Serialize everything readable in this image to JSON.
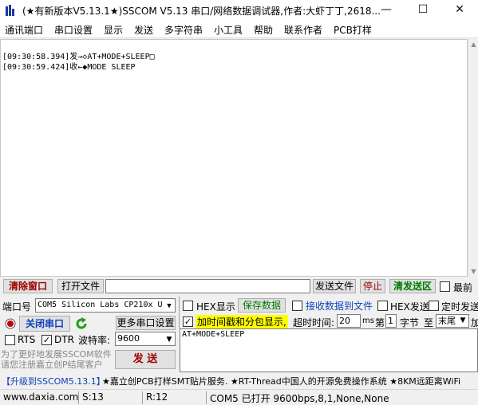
{
  "window": {
    "title": "(★有新版本V5.13.1★)SSCOM V5.13 串口/网络数据调试器,作者:大虾丁丁,2618...",
    "min_glyph": "—",
    "max_glyph": "☐",
    "close_glyph": "✕"
  },
  "menu": [
    "通讯端口",
    "串口设置",
    "显示",
    "发送",
    "多字符串",
    "小工具",
    "帮助",
    "联系作者",
    "PCB打样"
  ],
  "receive": {
    "lines": [
      "[09:30:58.394]发→◇AT+MODE+SLEEP□",
      "[09:30:59.424]收←◆MODE SLEEP"
    ]
  },
  "toolbar": {
    "clear_window": "清除窗口",
    "open_file": "打开文件",
    "send_file": "发送文件",
    "stop": "停止",
    "clear_send": "清发送区",
    "topmost": "最前"
  },
  "port": {
    "label": "端口号",
    "value": "COM5 Silicon Labs CP210x U",
    "close_port": "关闭串口",
    "more_settings": "更多串口设置",
    "rts": "RTS",
    "dtr": "DTR",
    "baud_label": "波特率:",
    "baud_value": "9600",
    "send": "发  送"
  },
  "options": {
    "hex_display": "HEX显示",
    "save_data": "保存数据",
    "save_to_file": "接收数据到文件",
    "hex_send": "HEX发送",
    "timed_send": "定时发送",
    "timestamp": "加时间戳和分包显示,",
    "timeout_label": "超时时间:",
    "timeout_value": "20",
    "timeout_unit": "ms",
    "nth_label": "第",
    "nth_value": "1",
    "byte_label": "字节",
    "to_label": "至",
    "end_value": "末尾",
    "add_label": "加"
  },
  "send_text": "AT+MODE+SLEEP",
  "promo": "为了更好地发展SSCOM软件\n请您注册嘉立创P结尾客户",
  "ticker": {
    "upgrade": "【升级到SSCOM5.13.1】",
    "text": "★嘉立创PCB打样SMT贴片服务. ★RT-Thread中国人的开源免费操作系统 ★8KM远距离WiFi"
  },
  "status": {
    "website": "www.daxia.com",
    "sent": "S:13",
    "received": "R:12",
    "port_status": "COM5 已打开  9600bps,8,1,None,None"
  },
  "colors": {
    "close_port_text": "#1040c0",
    "clear_window_text": "#a00000",
    "save_text": "#007a00",
    "timestamp_bg": "#ffff00",
    "send_arrow": "#1e9e1e"
  }
}
